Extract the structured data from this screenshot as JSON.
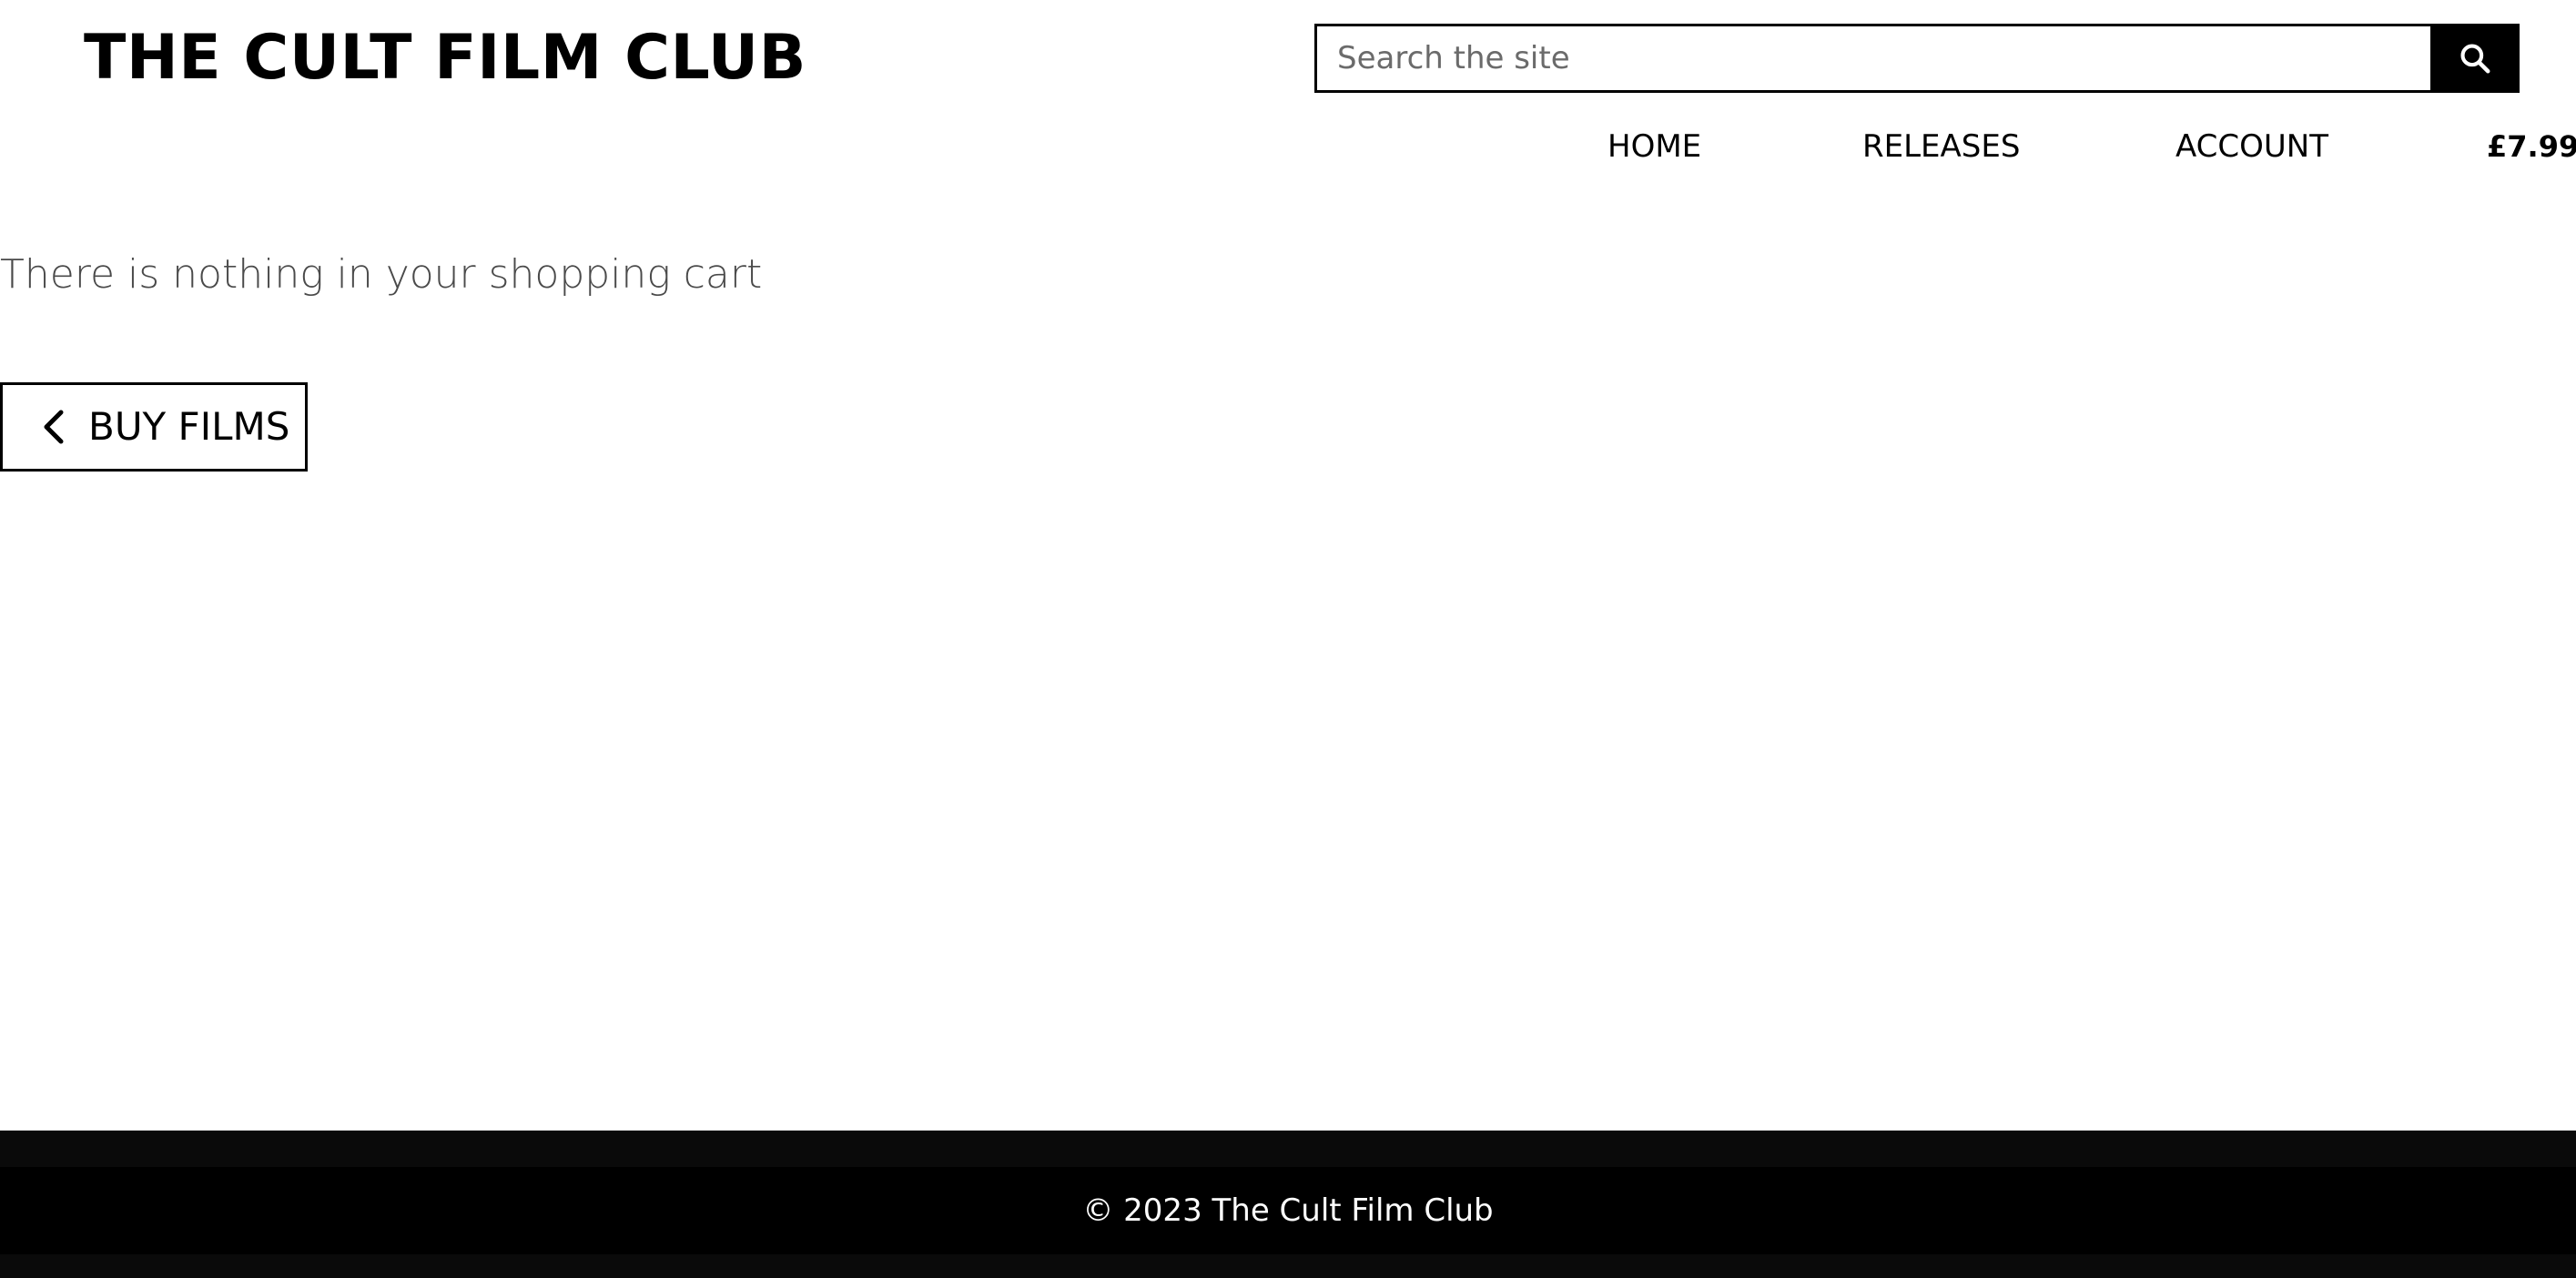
{
  "header": {
    "site_title": "THE CULT FILM CLUB",
    "search_placeholder": "Search the site",
    "search_icon": "search-icon"
  },
  "nav": {
    "home": "HOME",
    "releases": "RELEASES",
    "account": "ACCOUNT",
    "cart_total": "£7.99"
  },
  "main": {
    "empty_cart_message": "There is nothing in your shopping cart",
    "buy_films_label": "BUY FILMS",
    "buy_films_icon": "chevron-left-icon"
  },
  "footer": {
    "copyright": "© 2023 The Cult Film Club"
  },
  "colors": {
    "background": "#ffffff",
    "text": "#000000",
    "muted_text": "#4a4a4a",
    "footer_background": "#000000"
  }
}
